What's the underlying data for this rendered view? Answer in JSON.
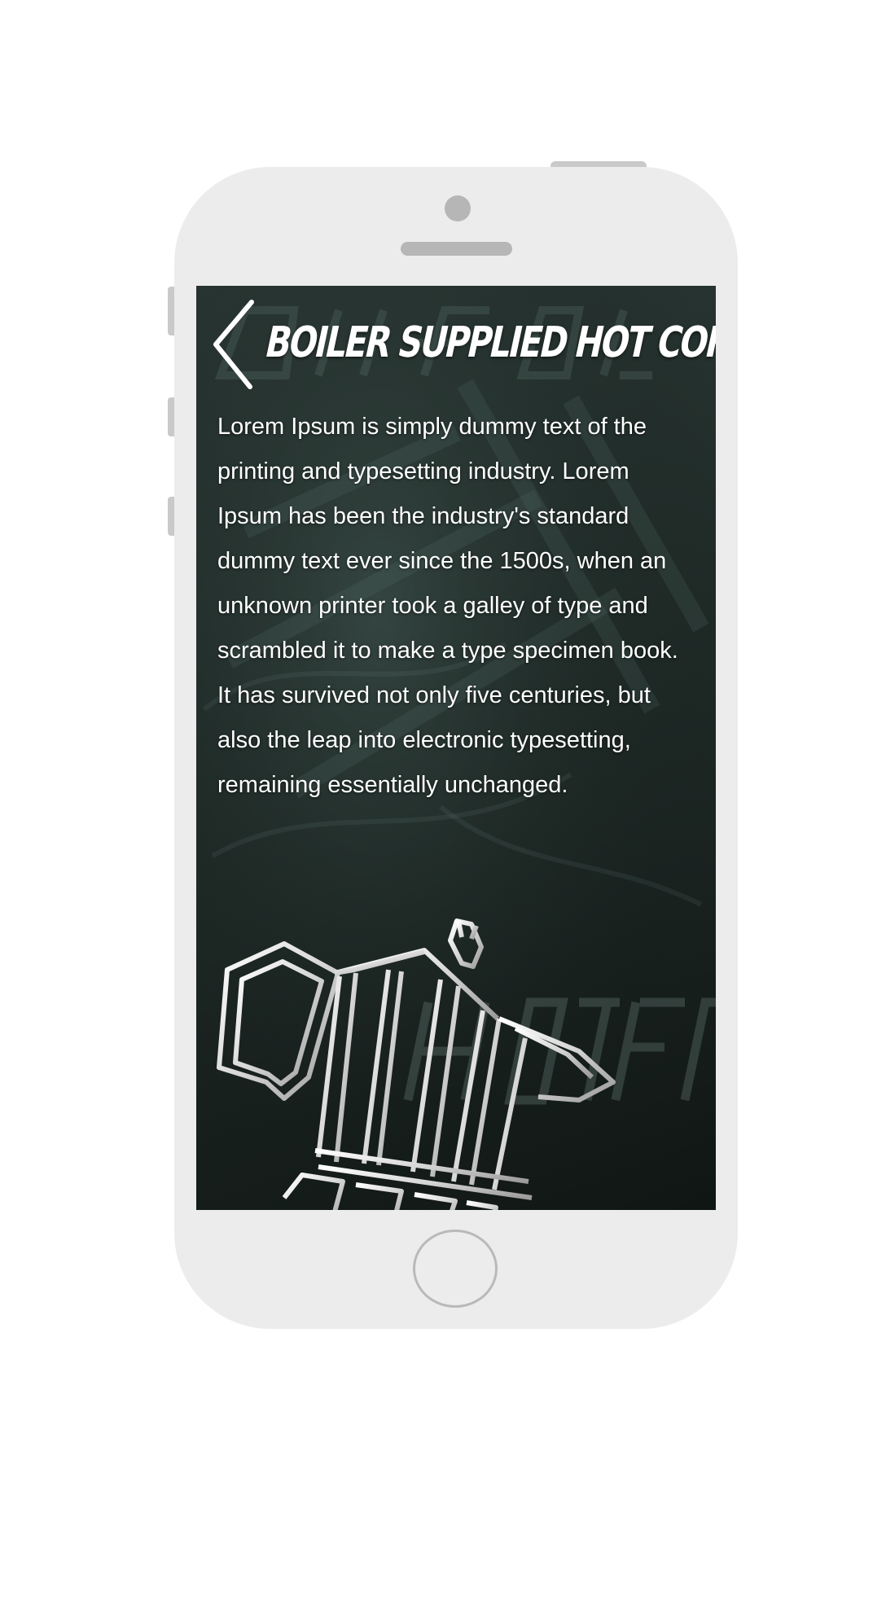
{
  "screen": {
    "title": "BOILER SUPPLIED HOT COFFEE",
    "body": "Lorem Ipsum is simply dummy text of the printing and typesetting industry. Lorem Ipsum has been the industry's standard dummy text ever since the 1500s, when an unknown printer took a galley of type and scrambled it to make a type specimen book. It has survived not only five centuries, but also the leap into electronic typesetting, remaining essentially unchanged.",
    "back_icon": "chevron-left-icon",
    "illustration_icon": "moka-pot-icon"
  },
  "device": {
    "frame_color": "#ececec",
    "detail_color": "#b6b6b6"
  }
}
